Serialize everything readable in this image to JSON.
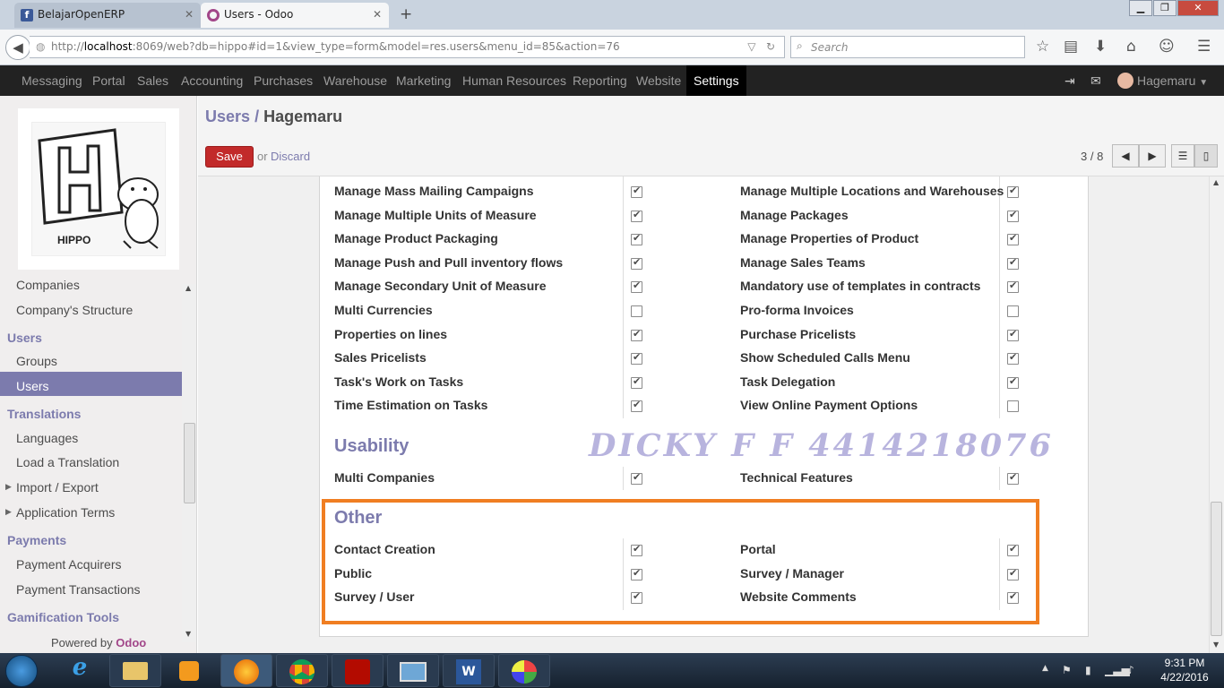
{
  "browser": {
    "tabs": [
      {
        "title": "BelajarOpenERP",
        "icon": "facebook-icon"
      },
      {
        "title": "Users - Odoo",
        "icon": "odoo-circle-icon"
      }
    ],
    "url_prefix": "http://",
    "url_host": "localhost",
    "url_rest": ":8069/web?db=hippo#id=1&view_type=form&model=res.users&menu_id=85&action=76",
    "search_placeholder": "Search"
  },
  "top_menu": {
    "items": [
      "Messaging",
      "Portal",
      "Sales",
      "Accounting",
      "Purchases",
      "Warehouse",
      "Marketing",
      "Human Resources",
      "Reporting",
      "Website"
    ],
    "active": "Settings",
    "user": "Hagemaru"
  },
  "sidebar": {
    "logo_text": "HIPPO",
    "items": [
      {
        "label": "Companies",
        "type": "item"
      },
      {
        "label": "Company's Structure",
        "type": "item"
      },
      {
        "label": "Users",
        "type": "head"
      },
      {
        "label": "Groups",
        "type": "item"
      },
      {
        "label": "Users",
        "type": "item",
        "active": true
      },
      {
        "label": "Translations",
        "type": "head"
      },
      {
        "label": "Languages",
        "type": "item"
      },
      {
        "label": "Load a Translation",
        "type": "item"
      },
      {
        "label": "Import / Export",
        "type": "expand"
      },
      {
        "label": "Application Terms",
        "type": "expand"
      },
      {
        "label": "Payments",
        "type": "head"
      },
      {
        "label": "Payment Acquirers",
        "type": "item"
      },
      {
        "label": "Payment Transactions",
        "type": "item"
      },
      {
        "label": "Gamification Tools",
        "type": "head"
      }
    ],
    "powered_by": "Powered by",
    "powered_brand": "Odoo"
  },
  "header": {
    "breadcrumb_parent": "Users",
    "breadcrumb_sep": "/",
    "breadcrumb_current": "Hagemaru",
    "save": "Save",
    "or": "or",
    "discard": "Discard",
    "pager": "3 / 8"
  },
  "form": {
    "rows": [
      {
        "left": "Manage Mass Mailing Campaigns",
        "left_checked": true,
        "right": "Manage Multiple Locations and Warehouses",
        "right_checked": true
      },
      {
        "left": "Manage Multiple Units of Measure",
        "left_checked": true,
        "right": "Manage Packages",
        "right_checked": true
      },
      {
        "left": "Manage Product Packaging",
        "left_checked": true,
        "right": "Manage Properties of Product",
        "right_checked": true
      },
      {
        "left": "Manage Push and Pull inventory flows",
        "left_checked": true,
        "right": "Manage Sales Teams",
        "right_checked": true
      },
      {
        "left": "Manage Secondary Unit of Measure",
        "left_checked": true,
        "right": "Mandatory use of templates in contracts",
        "right_checked": true
      },
      {
        "left": "Multi Currencies",
        "left_checked": false,
        "right": "Pro-forma Invoices",
        "right_checked": false
      },
      {
        "left": "Properties on lines",
        "left_checked": true,
        "right": "Purchase Pricelists",
        "right_checked": true
      },
      {
        "left": "Sales Pricelists",
        "left_checked": true,
        "right": "Show Scheduled Calls Menu",
        "right_checked": true
      },
      {
        "left": "Task's Work on Tasks",
        "left_checked": true,
        "right": "Task Delegation",
        "right_checked": true
      },
      {
        "left": "Time Estimation on Tasks",
        "left_checked": true,
        "right": "View Online Payment Options",
        "right_checked": false
      }
    ],
    "usability_title": "Usability",
    "usability_rows": [
      {
        "left": "Multi Companies",
        "left_checked": true,
        "right": "Technical Features",
        "right_checked": true
      }
    ],
    "other_title": "Other",
    "other_rows": [
      {
        "left": "Contact Creation",
        "left_checked": true,
        "right": "Portal",
        "right_checked": true
      },
      {
        "left": "Public",
        "left_checked": true,
        "right": "Survey / Manager",
        "right_checked": true
      },
      {
        "left": "Survey / User",
        "left_checked": true,
        "right": "Website Comments",
        "right_checked": true
      }
    ],
    "watermark": "DICKY F F 4414218076"
  },
  "taskbar": {
    "time": "9:31 PM",
    "date": "4/22/2016"
  }
}
